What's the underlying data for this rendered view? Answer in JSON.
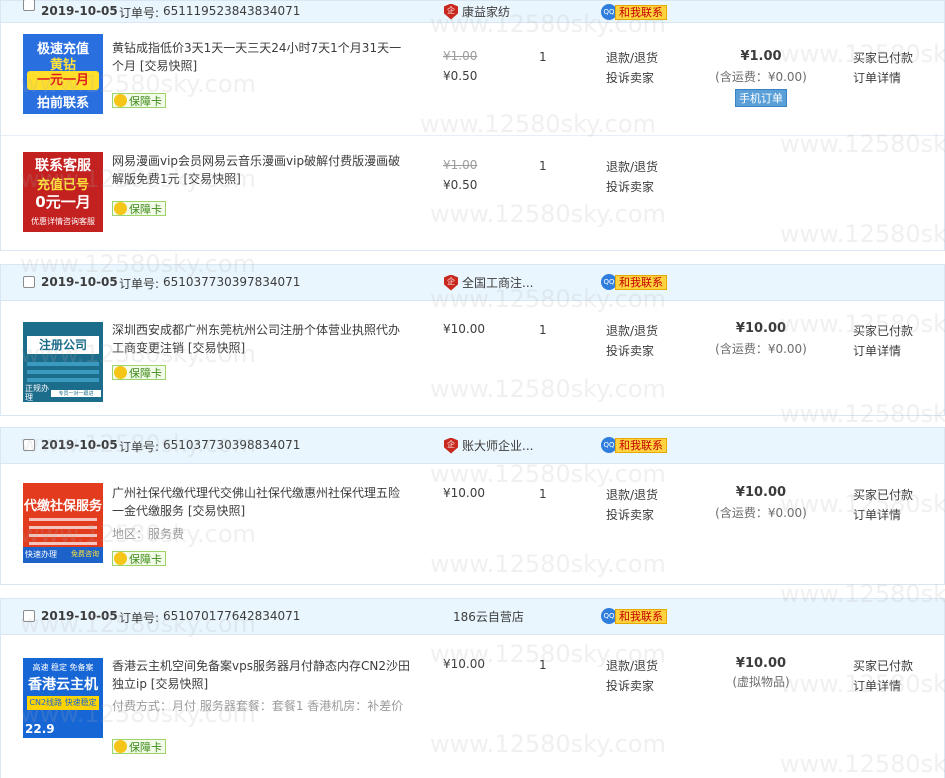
{
  "common": {
    "order_no_label": "订单号:",
    "contact_label": "和我联系",
    "protect_label": "保障卡",
    "snapshot": "[交易快照]",
    "refund": "退款/退货",
    "complain": "投诉卖家",
    "status": "买家已付款",
    "detail": "订单详情",
    "mobile_order": "手机订单"
  },
  "watermark": "www.12580sky.com",
  "orders": [
    {
      "date": "2019-10-05",
      "order_no": "651119523843834071",
      "shop": "康益家纺",
      "total": "¥1.00",
      "shipping": "(含运费：¥0.00)",
      "items": [
        {
          "thumb": {
            "l1": "极速充值",
            "l2": "黄钻",
            "l3": "一元一月",
            "l4": "拍前联系"
          },
          "title": "黄钻成指低价3天1天一天三天24小时7天1个月31天一个月",
          "orig_price": "¥1.00",
          "price": "¥0.50",
          "qty": "1"
        },
        {
          "thumb": {
            "l1": "联系客服",
            "l2": "充值已号",
            "l3": "0元一月",
            "l4": "优惠详情咨询客服"
          },
          "title": "网易漫画vip会员网易云音乐漫画vip破解付费版漫画破解版免费1元",
          "orig_price": "¥1.00",
          "price": "¥0.50",
          "qty": "1"
        }
      ]
    },
    {
      "date": "2019-10-05",
      "order_no": "651037730397834071",
      "shop": "全国工商注...",
      "total": "¥10.00",
      "shipping": "(含运费：¥0.00)",
      "items": [
        {
          "thumb": {
            "l1": "注册公司",
            "l2": "正规办理",
            "l3": "专员一对一跟进"
          },
          "title": "深圳西安成都广州东莞杭州公司注册个体营业执照代办工商变更注销",
          "price": "¥10.00",
          "qty": "1"
        }
      ]
    },
    {
      "date": "2019-10-05",
      "order_no": "651037730398834071",
      "shop": "账大师企业...",
      "total": "¥10.00",
      "shipping": "(含运费：¥0.00)",
      "items": [
        {
          "thumb": {
            "l1": "代缴社保服务",
            "l2": "快速办理",
            "l3": "免费咨询"
          },
          "title": "广州社保代缴代理代交佛山社保代缴惠州社保代理五险一金代缴服务",
          "sku": "地区：服务费",
          "price": "¥10.00",
          "qty": "1"
        }
      ]
    },
    {
      "date": "2019-10-05",
      "order_no": "651070177642834071",
      "shop": "186云自营店",
      "total": "¥10.00",
      "shipping": "(虚拟物品)",
      "items": [
        {
          "thumb": {
            "l1": "高速 稳定 免备案",
            "l2": "香港云主机",
            "l3": "CN2线路 快速稳定",
            "l4": "22.9"
          },
          "title": "香港云主机空间免备案vps服务器月付静态内存CN2沙田独立ip",
          "sku": "付费方式：月付   服务器套餐：套餐1   香港机房：补差价",
          "price": "¥10.00",
          "qty": "1"
        }
      ]
    }
  ]
}
